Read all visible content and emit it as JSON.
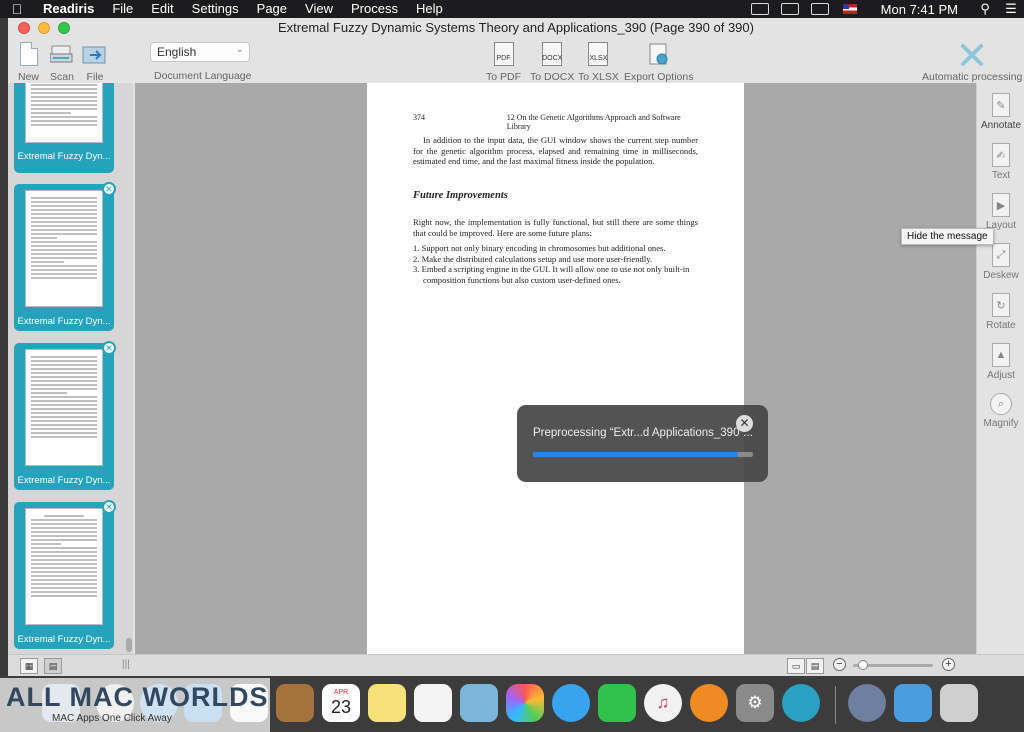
{
  "menubar": {
    "app_name": "Readiris",
    "items": [
      "File",
      "Edit",
      "Settings",
      "Page",
      "View",
      "Process",
      "Help"
    ],
    "clock": "Mon 7:41 PM"
  },
  "window": {
    "title": "Extremal Fuzzy Dynamic Systems Theory and Applications_390 (Page 390 of 390)"
  },
  "toolbar": {
    "new_label": "New",
    "scan_label": "Scan",
    "file_label": "File",
    "language_value": "English",
    "language_label": "Document Language",
    "to_pdf_label": "To PDF",
    "to_docx_label": "To DOCX",
    "to_xlsx_label": "To XLSX",
    "export_options_label": "Export Options",
    "automatic_processing_label": "Automatic processing",
    "pdf_tag": "PDF",
    "docx_tag": "DOCX",
    "xlsx_tag": "XLSX"
  },
  "sidebar": {
    "thumbnails": [
      {
        "label": "Extremal Fuzzy Dyn..."
      },
      {
        "label": "Extremal Fuzzy Dyn..."
      },
      {
        "label": "Extremal Fuzzy Dyn..."
      },
      {
        "label": "Extremal Fuzzy Dyn..."
      }
    ]
  },
  "page": {
    "page_number": "374",
    "running_header": "12   On the Genetic Algorithms Approach and Software Library",
    "para1": "In addition to the input data, the GUI window shows the current step number for the genetic algorithm process, elapsed and remaining time in milliseconds, estimated end time, and the last maximal fitness inside the population.",
    "heading": "Future Improvements",
    "para2": "Right now, the implementation is fully functional, but still there are some things that could be improved. Here are some future plans:",
    "list": [
      "1.  Support not only binary encoding in chromosomes but additional ones.",
      "2.  Make the distributed calculations setup and use more user-friendly.",
      "3.  Embed a scripting engine in the GUI. It will allow one to use not only built-in composition functions but also custom user-defined ones."
    ]
  },
  "progress": {
    "text": "Preprocessing “Extr...d Applications_390”...",
    "value_percent": 93
  },
  "right_panel": {
    "annotate": "Annotate",
    "text": "Text",
    "layout": "Layout",
    "deskew": "Deskew",
    "rotate": "Rotate",
    "adjust": "Adjust",
    "magnify": "Magnify",
    "tooltip": "Hide the message"
  },
  "bottombar": {
    "zoom_percent": 12
  },
  "dock": {
    "calendar_month": "APR",
    "calendar_day": "23"
  },
  "watermark": {
    "title": "ALL MAC WORLDS",
    "subtitle": "MAC Apps One Click Away"
  },
  "colors": {
    "accent": "#26a3bc",
    "progress": "#2d84e8"
  }
}
